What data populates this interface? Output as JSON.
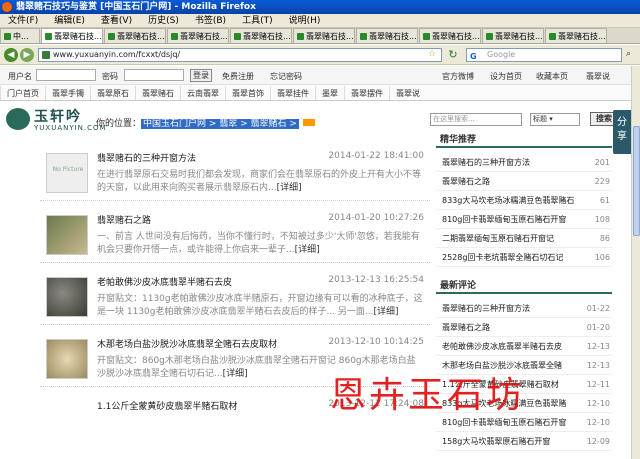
{
  "window": {
    "title": "翡翠赌石技巧与鉴赏 [中国玉石门户网] - Mozilla Firefox"
  },
  "menu": [
    "文件(F)",
    "编辑(E)",
    "查看(V)",
    "历史(S)",
    "书签(B)",
    "工具(T)",
    "说明(H)"
  ],
  "tabs": [
    "中...",
    "翡翠赌石技...",
    "翡翠赌石技...",
    "翡翠赌石技...",
    "翡翠赌石技...",
    "翡翠赌石技...",
    "翡翠赌石技...",
    "翡翠赌石技...",
    "翡翠赌石技...",
    "翡翠赌石技..."
  ],
  "nav": {
    "url": "www.yuxuanyin.com/fcxxt/dsjq/",
    "search_placeholder": "Google",
    "search_brand": "G"
  },
  "login": {
    "user_label": "用户名",
    "pass_label": "密码",
    "login_button": "登录",
    "register": "免费注册",
    "forgot": "忘记密码",
    "links": [
      "官方微博",
      "设为首页",
      "收藏本页",
      "翡翠说"
    ]
  },
  "categories": [
    "门户首页",
    "翡翠手镯",
    "翡翠原石",
    "翡翠赌石",
    "云南翡翠",
    "翡翠首饰",
    "翡翠挂件",
    "墨翠",
    "翡翠摆件",
    "翡翠说"
  ],
  "logo": {
    "cn": "玉轩吟",
    "en": "YUXUANYIN.COM"
  },
  "breadcrumb": {
    "prefix": "你的位置：",
    "path": "中国玉石门户网 > 翡翠 > 翡翠赌石 >"
  },
  "site_search": {
    "placeholder": "在这里搜索...",
    "select": "标题",
    "button": "搜索"
  },
  "articles": [
    {
      "title": "翡翠赌石的三种开窗方法",
      "date": "2014-01-22 18:41:00",
      "desc": "在进行翡翠原石交易时我们都会发现，商家们会在翡翠原石的外皮上开有大小不等的天窗，以此用来向购买者展示翡翠原石内...",
      "more": "[详细]",
      "nopic": "No Picture"
    },
    {
      "title": "翡翠赌石之路",
      "date": "2014-01-20 10:27:26",
      "desc": "一、前言 人世间没有后悔药，当你不懂行时，不知被过多少'大师'忽悠，若我能有机会只要你开悟一点，或许能得上你启来一辈子...",
      "more": "[详细]",
      "nopic": ""
    },
    {
      "title": "老帕敢佛沙皮冰底翡翠半赌石去皮",
      "date": "2013-12-13 16:25:54",
      "desc": "开窗贴文：1130g老帕敢佛沙皮冰底半赌原石，开窗边缘有可以看的冰种底子，这是一块 1130g老帕敢佛沙皮冰底翡翠半赌石去皮后的样子... 另一面...",
      "more": "[详细]",
      "nopic": ""
    },
    {
      "title": "木那老场白盐沙脱沙冰底翡翠全赌石去皮取材",
      "date": "2013-12-10 10:14:25",
      "desc": "开窗贴文：860g木那老场白盐沙脱沙冰底翡翠全赌石开窗记 860g木那老场白盐沙脱沙冰底翡翠全赌石切石记...",
      "more": "[详细]",
      "nopic": ""
    },
    {
      "title": "1.1公斤全蒙黄砂皮翡翠半赌石取材",
      "date": "2013-12-11 17:24:08",
      "desc": "",
      "more": "",
      "nopic": ""
    }
  ],
  "sidebar": {
    "featured_title": "精华推荐",
    "featured": [
      {
        "t": "翡翠赌石的三种开窗方法",
        "n": "201"
      },
      {
        "t": "翡翠赌石之路",
        "n": "229"
      },
      {
        "t": "833g大马坎老场冰糯满豆色翡翠赌石",
        "n": "61"
      },
      {
        "t": "810g回卡翡翠缅甸玉原石赌石开窗",
        "n": "108"
      },
      {
        "t": "二期翡翠缅甸玉原石赌石开窗记",
        "n": "86"
      },
      {
        "t": "2528g回卡老坑翡翠全赌石切石记",
        "n": "106"
      }
    ],
    "latest_title": "最新评论",
    "latest": [
      {
        "t": "翡翠赌石的三种开窗方法",
        "n": "01-22"
      },
      {
        "t": "翡翠赌石之路",
        "n": "01-20"
      },
      {
        "t": "老帕敢佛沙皮冰底翡翠半赌石去皮",
        "n": "12-13"
      },
      {
        "t": "木那老场白盐沙脱沙冰底翡翠全赌",
        "n": "12-13"
      },
      {
        "t": "1.1公斤全蒙黄砂皮翡翠赌石取材",
        "n": "12-11"
      },
      {
        "t": "833g大马坎老场冰糯满豆色翡翠赌",
        "n": "12-10"
      },
      {
        "t": "810g回卡翡翠缅甸玉原石赌石开窗",
        "n": "12-10"
      },
      {
        "t": "158g大马坎翡翠原石赌石开窗",
        "n": "12-09"
      }
    ]
  },
  "share": "分享",
  "watermark": "恩卉玉石坊"
}
